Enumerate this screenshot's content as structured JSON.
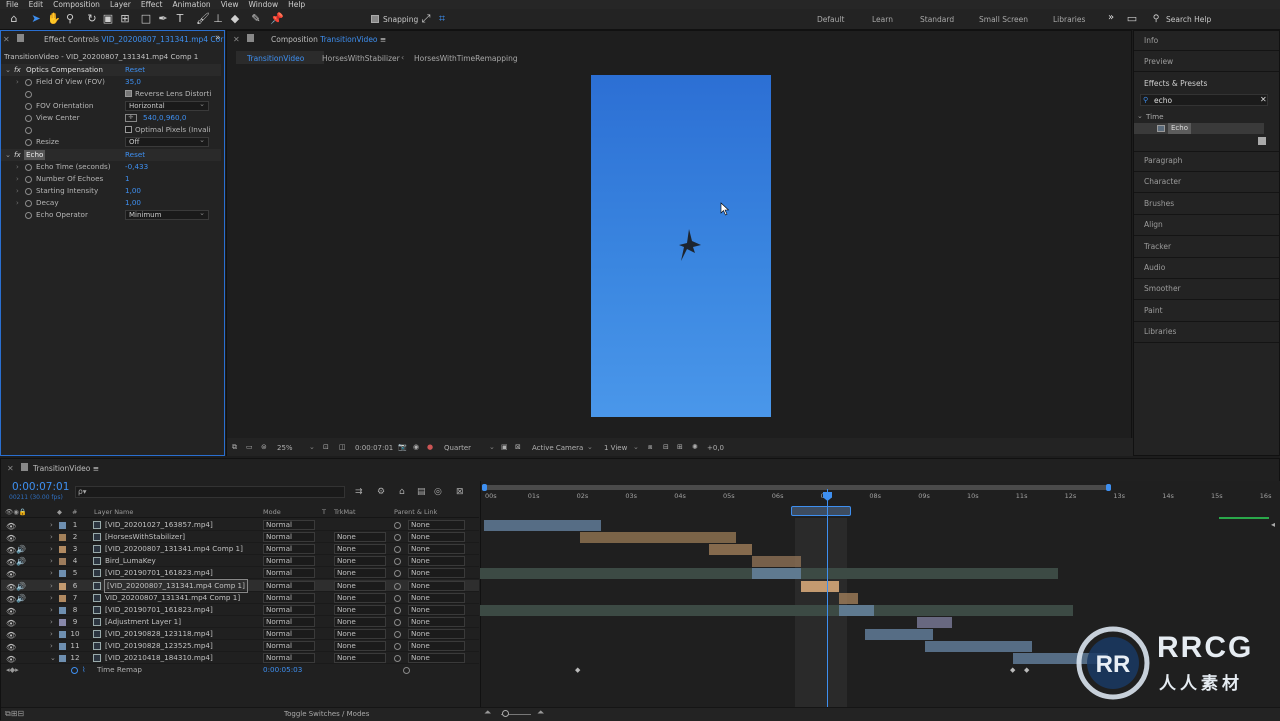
{
  "menu": [
    "File",
    "Edit",
    "Composition",
    "Layer",
    "Effect",
    "Animation",
    "View",
    "Window",
    "Help"
  ],
  "toolbar": {
    "snapping_label": "Snapping",
    "workspaces": [
      "Default",
      "Learn",
      "Standard",
      "Small Screen",
      "Libraries"
    ],
    "more": "»",
    "search_label": "Search Help"
  },
  "effect_controls": {
    "tab_label": "Effect Controls",
    "tab_file": "VID_20200807_131341.mp4 Cor",
    "layer_path": "TransitionVideo - VID_20200807_131341.mp4 Comp 1",
    "optics": {
      "name": "Optics Compensation",
      "reset": "Reset",
      "fov_label": "Field Of View (FOV)",
      "fov_value": "35,0",
      "reverse_label": "Reverse Lens Distorti",
      "orientation_label": "FOV Orientation",
      "orientation_value": "Horizontal",
      "view_center_label": "View Center",
      "view_center_value": "540,0,960,0",
      "optimal_label": "Optimal Pixels (Invali",
      "resize_label": "Resize",
      "resize_value": "Off"
    },
    "echo": {
      "name": "Echo",
      "reset": "Reset",
      "time_label": "Echo Time (seconds)",
      "time_value": "-0,433",
      "num_label": "Number Of Echoes",
      "num_value": "1",
      "start_label": "Starting Intensity",
      "start_value": "1,00",
      "decay_label": "Decay",
      "decay_value": "1,00",
      "operator_label": "Echo Operator",
      "operator_value": "Minimum"
    }
  },
  "composition": {
    "panel_label": "Composition",
    "panel_name": "TransitionVideo",
    "breadcrumbs": [
      "TransitionVideo",
      "HorsesWithStabilizer",
      "HorsesWithTimeRemapping"
    ],
    "zoom": "25%",
    "timecode": "0:00:07:01",
    "resolution": "Quarter",
    "camera": "Active Camera",
    "views": "1 View",
    "exposure": "+0,0"
  },
  "right_panel": {
    "info": "Info",
    "preview": "Preview",
    "effects_presets": "Effects & Presets",
    "search_value": "echo",
    "category": "Time",
    "result": "Echo",
    "items": [
      "Paragraph",
      "Character",
      "Brushes",
      "Align",
      "Tracker",
      "Audio",
      "Smoother",
      "Paint",
      "Libraries"
    ]
  },
  "timeline": {
    "tab": "TransitionVideo",
    "timecode": "0:00:07:01",
    "frames": "00211 (30.00 fps)",
    "search_placeholder": "ρ▾",
    "col_num": "#",
    "col_name": "Layer Name",
    "col_mode": "Mode",
    "col_t": "T",
    "col_trkmat": "TrkMat",
    "col_parent": "Parent & Link",
    "ruler": [
      "00s",
      "01s",
      "02s",
      "03s",
      "04s",
      "05s",
      "06s",
      "07s",
      "08s",
      "09s",
      "10s",
      "11s",
      "12s",
      "13s",
      "14s",
      "15s",
      "16s"
    ],
    "time_remap_label": "Time Remap",
    "time_remap_value": "0:00:05:03",
    "toggle": "Toggle Switches / Modes",
    "layers": [
      {
        "num": "1",
        "name": "[VID_20201027_163857.mp4]",
        "mode": "Normal",
        "trk": "",
        "parent": "None",
        "color": "#6e8fb0",
        "audio": false
      },
      {
        "num": "2",
        "name": "[HorsesWithStabilizer]",
        "mode": "Normal",
        "trk": "None",
        "parent": "None",
        "color": "#a3815a",
        "audio": false
      },
      {
        "num": "3",
        "name": "[VID_20200807_131341.mp4 Comp 1]",
        "mode": "Normal",
        "trk": "None",
        "parent": "None",
        "color": "#b18a61",
        "audio": true
      },
      {
        "num": "4",
        "name": "Bird_LumaKey",
        "mode": "Normal",
        "trk": "None",
        "parent": "None",
        "color": "#9d7c5c",
        "audio": true
      },
      {
        "num": "5",
        "name": "[VID_20190701_161823.mp4]",
        "mode": "Normal",
        "trk": "None",
        "parent": "None",
        "color": "#6e8fb0",
        "audio": false
      },
      {
        "num": "6",
        "name": "[VID_20200807_131341.mp4 Comp 1]",
        "mode": "Normal",
        "trk": "None",
        "parent": "None",
        "color": "#c39a70",
        "audio": true
      },
      {
        "num": "7",
        "name": "VID_20200807_131341.mp4 Comp 1]",
        "mode": "Normal",
        "trk": "None",
        "parent": "None",
        "color": "#b18a61",
        "audio": true
      },
      {
        "num": "8",
        "name": "[VID_20190701_161823.mp4]",
        "mode": "Normal",
        "trk": "None",
        "parent": "None",
        "color": "#6e8fb0",
        "audio": false
      },
      {
        "num": "9",
        "name": "[Adjustment Layer 1]",
        "mode": "Normal",
        "trk": "None",
        "parent": "None",
        "color": "#8888aa",
        "audio": false
      },
      {
        "num": "10",
        "name": "[VID_20190828_123118.mp4]",
        "mode": "Normal",
        "trk": "None",
        "parent": "None",
        "color": "#6e8fb0",
        "audio": false
      },
      {
        "num": "11",
        "name": "[VID_20190828_123525.mp4]",
        "mode": "Normal",
        "trk": "None",
        "parent": "None",
        "color": "#6e8fb0",
        "audio": false
      },
      {
        "num": "12",
        "name": "[VID_20210418_184310.mp4]",
        "mode": "Normal",
        "trk": "None",
        "parent": "None",
        "color": "#6e8fb0",
        "audio": false
      }
    ]
  },
  "watermark": {
    "brand": "RRCG",
    "sub": "人人素材"
  }
}
